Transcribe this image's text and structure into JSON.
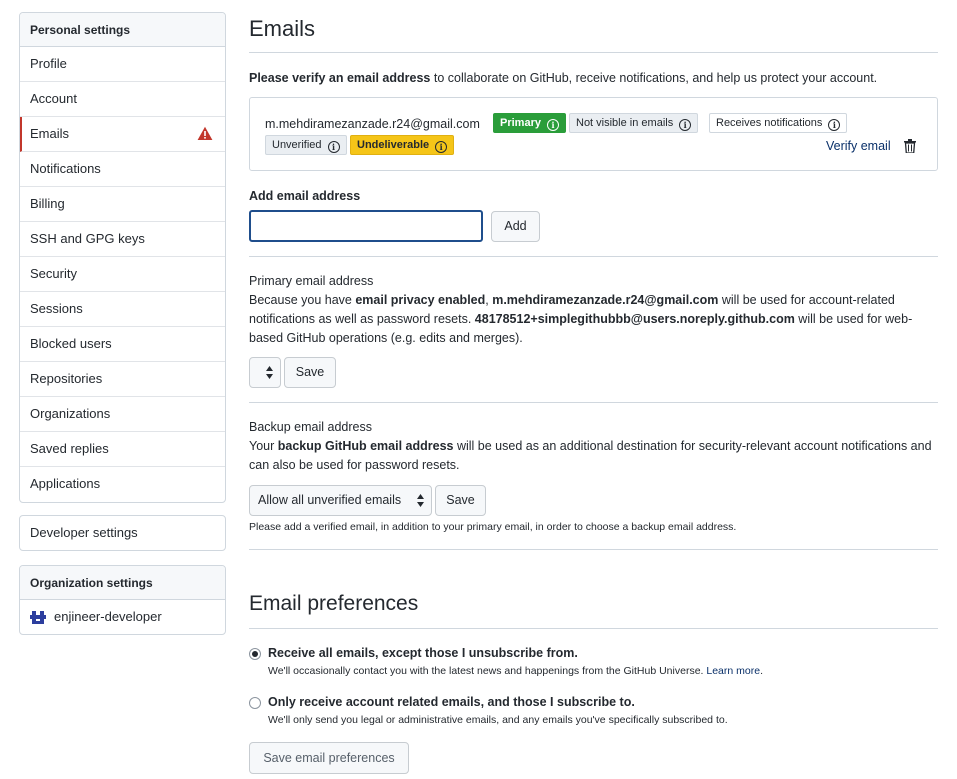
{
  "sidebar": {
    "personal_header": "Personal settings",
    "items": [
      {
        "label": "Profile"
      },
      {
        "label": "Account"
      },
      {
        "label": "Emails",
        "selected": true,
        "warning": true
      },
      {
        "label": "Notifications"
      },
      {
        "label": "Billing"
      },
      {
        "label": "SSH and GPG keys"
      },
      {
        "label": "Security"
      },
      {
        "label": "Sessions"
      },
      {
        "label": "Blocked users"
      },
      {
        "label": "Repositories"
      },
      {
        "label": "Organizations"
      },
      {
        "label": "Saved replies"
      },
      {
        "label": "Applications"
      }
    ],
    "developer_settings": "Developer settings",
    "org_header": "Organization settings",
    "org_name": "enjineer-developer"
  },
  "emails": {
    "title": "Emails",
    "lead_bold": "Please verify an email address",
    "lead_rest": " to collaborate on GitHub, receive notifications, and help us protect your account.",
    "address": "m.mehdiramezanzade.r24@gmail.com",
    "badges": {
      "primary": "Primary",
      "not_visible": "Not visible in emails",
      "receives": "Receives notifications",
      "unverified": "Unverified",
      "undeliverable": "Undeliverable"
    },
    "verify_link": "Verify email",
    "add_label": "Add email address",
    "add_input_value": "",
    "add_button": "Add"
  },
  "primary_section": {
    "label": "Primary email address",
    "p1": "Because you have ",
    "p1_bold": "email privacy enabled",
    "p1_b": ", ",
    "p1_email": "m.mehdiramezanzade.r24@gmail.com",
    "p1_c": " will be used for account-related notifications as well as password resets. ",
    "p1_noreply": "48178512+simplegithubbb@users.noreply.github.com",
    "p1_d": " will be used for web-based GitHub operations (e.g. edits and merges).",
    "select_value": "",
    "save_button": "Save"
  },
  "backup_section": {
    "label": "Backup email address",
    "p_a": "Your ",
    "p_bold": "backup GitHub email address",
    "p_b": " will be used as an additional destination for security-relevant account notifications and can also be used for password resets.",
    "select_value": "Allow all unverified emails",
    "save_button": "Save",
    "note": "Please add a verified email, in addition to your primary email, in order to choose a backup email address."
  },
  "preferences": {
    "title": "Email preferences",
    "opt1_title": "Receive all emails, except those I unsubscribe from.",
    "opt1_desc": "We'll occasionally contact you with the latest news and happenings from the GitHub Universe. ",
    "opt1_link": "Learn more",
    "opt1_selected": true,
    "opt2_title": "Only receive account related emails, and those I subscribe to.",
    "opt2_desc": "We'll only send you legal or administrative emails, and any emails you've specifically subscribed to.",
    "save_button": "Save email preferences"
  },
  "colors": {
    "primary_badge": "#2a9d3a",
    "undeliverable_badge": "#f5c518",
    "selected_border": "#c2362b",
    "warning_icon": "#c2362b",
    "link": "#0a3069"
  },
  "icons": [
    "alert-triangle-icon",
    "info-icon",
    "trash-icon",
    "select-updown-icon",
    "org-avatar-icon"
  ]
}
